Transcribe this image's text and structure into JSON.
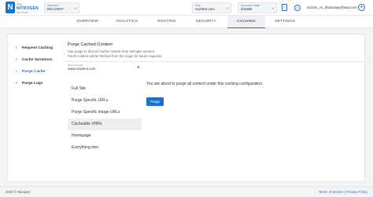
{
  "brand": {
    "line1": "THE",
    "line2": "NITROGEN",
    "line3": "NETWORK",
    "logo_letter": "N"
  },
  "product_select": {
    "label": "PRODUCT",
    "value": "DELIVERY"
  },
  "site_select": {
    "label": "SITE",
    "value": "nvizitest.com"
  },
  "account_select": {
    "label": "ACCOUNT NAME",
    "value": "331886"
  },
  "user": {
    "email": "nvizion_vo_dhananjay@aviv.com"
  },
  "tabs": [
    {
      "label": "OVERVIEW"
    },
    {
      "label": "ANALYTICS"
    },
    {
      "label": "ROUTING"
    },
    {
      "label": "SECURITY"
    },
    {
      "label": "CACHING",
      "active": true
    },
    {
      "label": "SETTINGS"
    }
  ],
  "sidebar": {
    "items": [
      {
        "label": "Request Caching"
      },
      {
        "label": "Cache Variations"
      },
      {
        "label": "Purge Cache",
        "active": true
      },
      {
        "label": "Purge Logs"
      }
    ]
  },
  "content": {
    "title": "Purge Cached Content",
    "desc_line1": "Use purge to discard cache content from Nitrogen servers.",
    "desc_line2": "Fresh content will be fetched from the origin for future requests.",
    "domain_label": "Select Domain",
    "domain_value": "www.nvizitest.com",
    "options": [
      {
        "label": "Full Site"
      },
      {
        "label": "Purge Specific URLs"
      },
      {
        "label": "Purge Specific Image URLs"
      },
      {
        "label": "Cacheable XHRs",
        "active": true
      },
      {
        "label": "Homepage"
      },
      {
        "label": "Everything else"
      }
    ],
    "message": "You are about to purge all content under this caching configuration.",
    "purge_label": "Purge"
  },
  "footer": {
    "copyright": "2023 © Nitrogen",
    "terms": "Terms of Service",
    "separator": "|",
    "privacy": "Privacy Policy"
  },
  "colors": {
    "accent": "#1d6fd1",
    "background": "#f1f3f5"
  },
  "icons": [
    "doc-icon",
    "info-icon",
    "avatar-icon",
    "chevron-down-icon",
    "close-icon",
    "chevron-right-icon"
  ]
}
